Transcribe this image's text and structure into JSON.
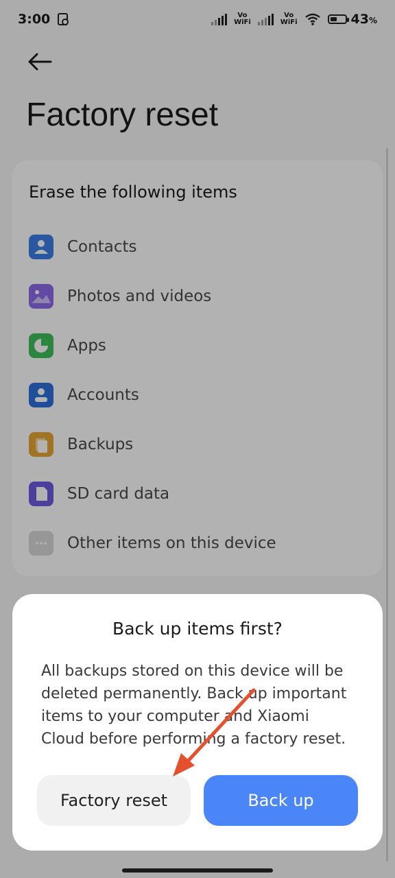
{
  "status_bar": {
    "time": "3:00",
    "vowifi_1_top": "Vo",
    "vowifi_1_bottom": "WiFi",
    "vowifi_2_top": "Vo",
    "vowifi_2_bottom": "WiFi",
    "battery_level": 43,
    "battery_value": "43",
    "battery_unit": "%"
  },
  "header": {
    "title": "Factory reset"
  },
  "erase_card": {
    "heading": "Erase the following items",
    "items": [
      {
        "label": "Contacts",
        "icon": "contacts-icon",
        "color": "#3d7fe6"
      },
      {
        "label": "Photos and videos",
        "icon": "photos-icon",
        "color": "#8a6bea"
      },
      {
        "label": "Apps",
        "icon": "apps-icon",
        "color": "#3fbf5a"
      },
      {
        "label": "Accounts",
        "icon": "accounts-icon",
        "color": "#2f6fd9"
      },
      {
        "label": "Backups",
        "icon": "backups-icon",
        "color": "#e6a734"
      },
      {
        "label": "SD card data",
        "icon": "sd-card-icon",
        "color": "#6a5ce0"
      },
      {
        "label": "Other items on this device",
        "icon": "more-icon",
        "color": "#d8d8d8"
      }
    ]
  },
  "dialog": {
    "title": "Back up items first?",
    "body": "All backups stored on this device will be deleted permanently. Back up important items to your computer and Xiaomi Cloud before performing a factory reset.",
    "factory_reset_label": "Factory reset",
    "back_up_label": "Back up"
  },
  "colors": {
    "accent": "#4a86f7",
    "annotation_arrow": "#e5502e"
  }
}
